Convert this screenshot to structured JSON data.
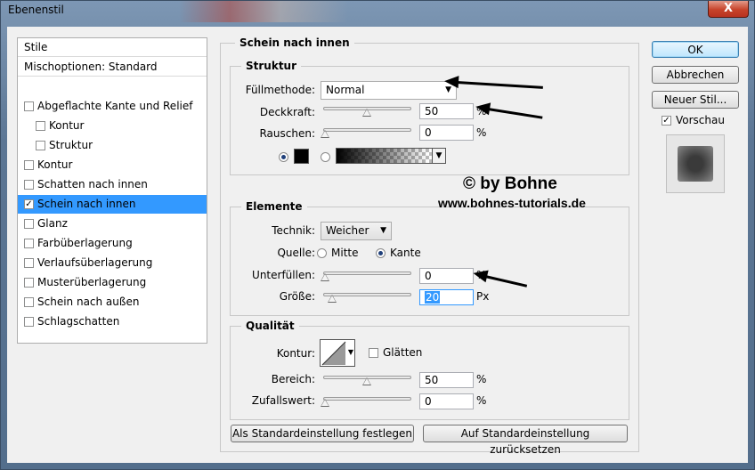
{
  "window": {
    "title": "Ebenenstil",
    "close_label": "X"
  },
  "styles_panel": {
    "header": "Stile",
    "blend_options": "Mischoptionen: Standard",
    "items": [
      {
        "label": "Abgeflachte Kante und Relief",
        "checked": false
      },
      {
        "label": "Kontur",
        "checked": false
      },
      {
        "label": "Struktur",
        "checked": false
      },
      {
        "label": "Kontur",
        "checked": false
      },
      {
        "label": "Schatten nach innen",
        "checked": false
      },
      {
        "label": "Schein nach innen",
        "checked": true
      },
      {
        "label": "Glanz",
        "checked": false
      },
      {
        "label": "Farbüberlagerung",
        "checked": false
      },
      {
        "label": "Verlaufsüberlagerung",
        "checked": false
      },
      {
        "label": "Musterüberlagerung",
        "checked": false
      },
      {
        "label": "Schein nach außen",
        "checked": false
      },
      {
        "label": "Schlagschatten",
        "checked": false
      }
    ]
  },
  "main": {
    "title": "Schein nach innen",
    "struktur": {
      "legend": "Struktur",
      "blend_mode_label": "Füllmethode:",
      "blend_mode_value": "Normal",
      "opacity_label": "Deckkraft:",
      "opacity_value": "50",
      "opacity_unit": "%",
      "opacity_level": 0.5,
      "noise_label": "Rauschen:",
      "noise_value": "0",
      "noise_unit": "%",
      "noise_level": 0,
      "color": "#000000"
    },
    "elemente": {
      "legend": "Elemente",
      "technique_label": "Technik:",
      "technique_value": "Weicher",
      "source_label": "Quelle:",
      "source_center": "Mitte",
      "source_edge": "Kante",
      "choke_label": "Unterfüllen:",
      "choke_value": "0",
      "choke_unit": "%",
      "choke_level": 0,
      "size_label": "Größe:",
      "size_value": "20",
      "size_unit": "Px",
      "size_level": 0.08
    },
    "qualitaet": {
      "legend": "Qualität",
      "contour_label": "Kontur:",
      "antialias_label": "Glätten",
      "range_label": "Bereich:",
      "range_value": "50",
      "range_unit": "%",
      "range_level": 0.5,
      "jitter_label": "Zufallswert:",
      "jitter_value": "0",
      "jitter_unit": "%",
      "jitter_level": 0
    },
    "make_default": "Als Standardeinstellung festlegen",
    "reset_default": "Auf Standardeinstellung zurücksetzen"
  },
  "buttons": {
    "ok": "OK",
    "cancel": "Abbrechen",
    "new_style": "Neuer Stil...",
    "preview": "Vorschau"
  },
  "watermark": {
    "line1": "© by Bohne",
    "line2": "www.bohnes-tutorials.de"
  }
}
